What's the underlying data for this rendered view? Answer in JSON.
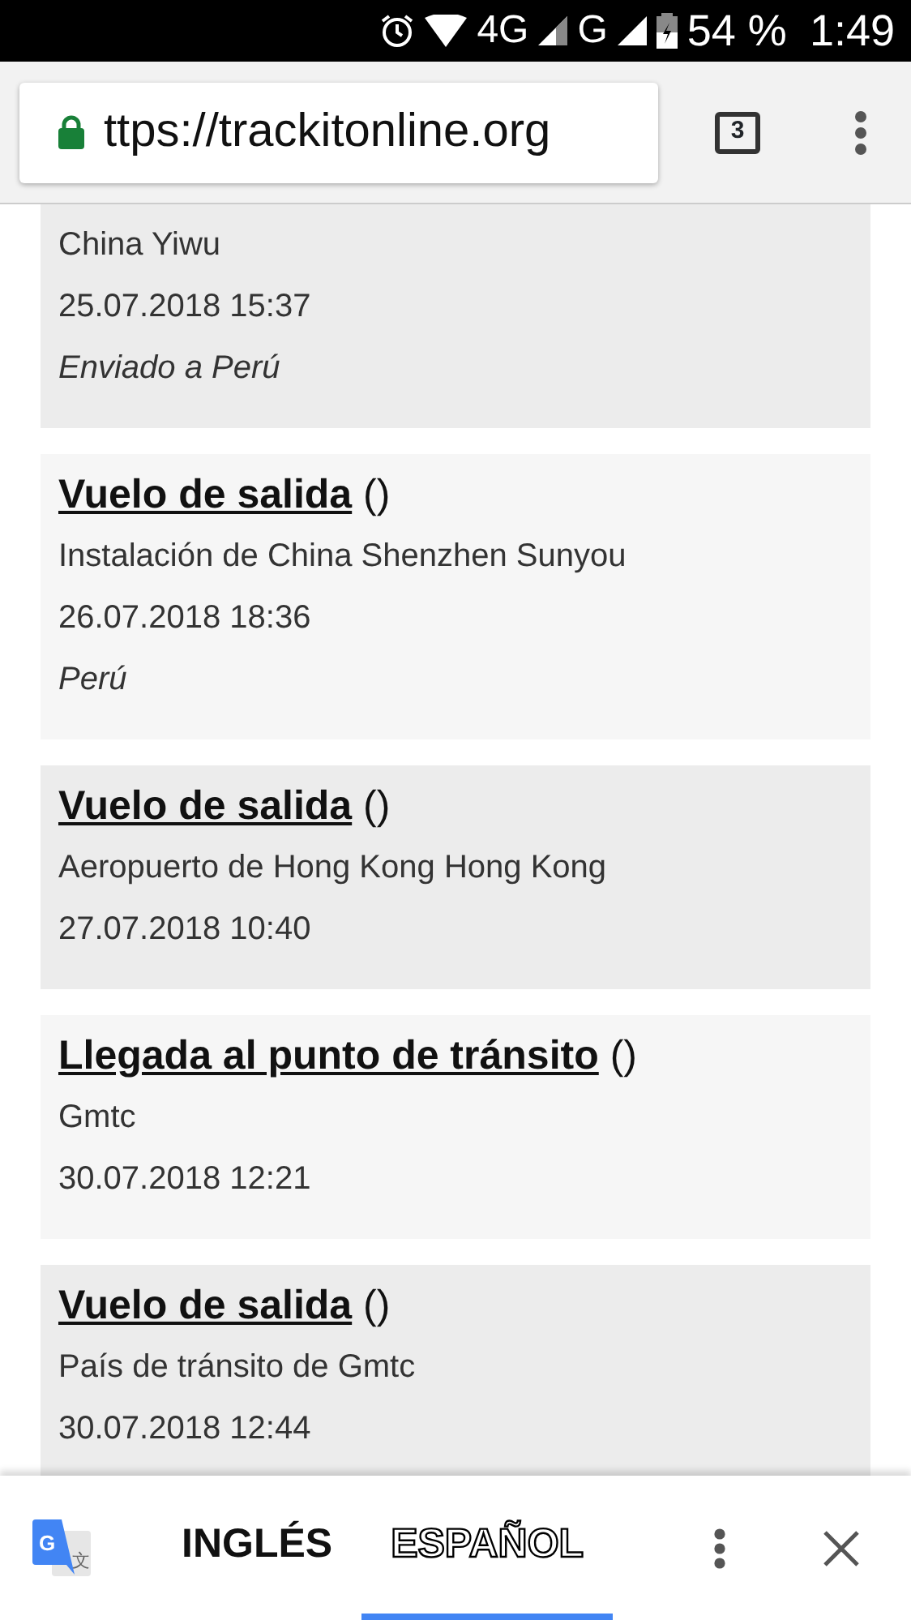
{
  "status_bar": {
    "network_1": "4G",
    "network_2": "G",
    "battery": "54 %",
    "time": "1:49"
  },
  "browser": {
    "url": "ttps://trackitonline.org",
    "secure": true,
    "tab_count": "3"
  },
  "events": [
    {
      "location": "China Yiwu",
      "datetime": "25.07.2018 15:37",
      "note": "Enviado a Perú"
    },
    {
      "title": "Vuelo de salida",
      "suffix": "()",
      "location": "Instalación de China Shenzhen Sunyou",
      "datetime": "26.07.2018 18:36",
      "note": "Perú"
    },
    {
      "title": "Vuelo de salida",
      "suffix": "()",
      "location": "Aeropuerto de Hong Kong Hong Kong",
      "datetime": "27.07.2018 10:40"
    },
    {
      "title": "Llegada al punto de tránsito",
      "suffix": "()",
      "location": "Gmtc",
      "datetime": "30.07.2018 12:21"
    },
    {
      "title": "Vuelo de salida",
      "suffix": "()",
      "location": "País de tránsito de Gmtc",
      "datetime": "30.07.2018 12:44"
    }
  ],
  "translate_bar": {
    "icon_letters": [
      "G",
      "文"
    ],
    "languages": [
      {
        "label": "INGLÉS",
        "selected": false
      },
      {
        "label": "ESPAÑOL",
        "selected": true
      }
    ]
  }
}
